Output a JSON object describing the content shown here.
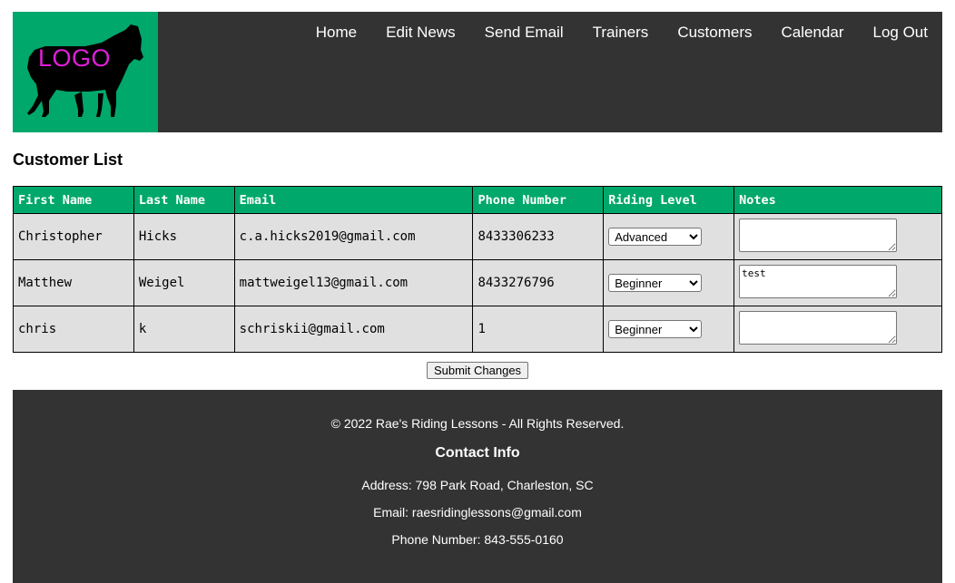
{
  "header": {
    "logo_text": "LOGO",
    "nav": [
      "Home",
      "Edit News",
      "Send Email",
      "Trainers",
      "Customers",
      "Calendar",
      "Log Out"
    ]
  },
  "page_title": "Customer List",
  "table": {
    "columns": [
      "First Name",
      "Last Name",
      "Email",
      "Phone Number",
      "Riding Level",
      "Notes"
    ],
    "rows": [
      {
        "first": "Christopher",
        "last": "Hicks",
        "email": "c.a.hicks2019@gmail.com",
        "phone": "8433306233",
        "level": "Advanced",
        "notes": ""
      },
      {
        "first": "Matthew",
        "last": "Weigel",
        "email": "mattweigel13@gmail.com",
        "phone": "8433276796",
        "level": "Beginner",
        "notes": "test"
      },
      {
        "first": "chris",
        "last": "k",
        "email": "schriskii@gmail.com",
        "phone": "1",
        "level": "Beginner",
        "notes": ""
      }
    ]
  },
  "submit_label": "Submit Changes",
  "footer": {
    "copyright": "© 2022 Rae's Riding Lessons - All Rights Reserved.",
    "contact_heading": "Contact Info",
    "address": "Address:  798 Park Road, Charleston, SC",
    "email": "Email:  raesridinglessons@gmail.com",
    "phone": "Phone Number:  843-555-0160"
  },
  "colors": {
    "accent": "#00a86b",
    "header_bg": "#333333",
    "logo_text": "#e01fd8",
    "cell_bg": "#e0e0e0"
  }
}
